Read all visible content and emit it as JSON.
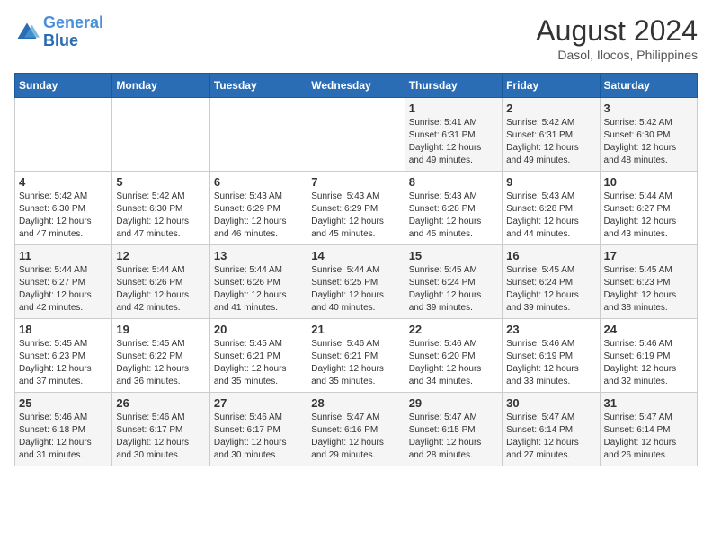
{
  "header": {
    "logo_line1": "General",
    "logo_line2": "Blue",
    "main_title": "August 2024",
    "subtitle": "Dasol, Ilocos, Philippines"
  },
  "days_of_week": [
    "Sunday",
    "Monday",
    "Tuesday",
    "Wednesday",
    "Thursday",
    "Friday",
    "Saturday"
  ],
  "weeks": [
    [
      {
        "day": "",
        "info": ""
      },
      {
        "day": "",
        "info": ""
      },
      {
        "day": "",
        "info": ""
      },
      {
        "day": "",
        "info": ""
      },
      {
        "day": "1",
        "info": "Sunrise: 5:41 AM\nSunset: 6:31 PM\nDaylight: 12 hours\nand 49 minutes."
      },
      {
        "day": "2",
        "info": "Sunrise: 5:42 AM\nSunset: 6:31 PM\nDaylight: 12 hours\nand 49 minutes."
      },
      {
        "day": "3",
        "info": "Sunrise: 5:42 AM\nSunset: 6:30 PM\nDaylight: 12 hours\nand 48 minutes."
      }
    ],
    [
      {
        "day": "4",
        "info": "Sunrise: 5:42 AM\nSunset: 6:30 PM\nDaylight: 12 hours\nand 47 minutes."
      },
      {
        "day": "5",
        "info": "Sunrise: 5:42 AM\nSunset: 6:30 PM\nDaylight: 12 hours\nand 47 minutes."
      },
      {
        "day": "6",
        "info": "Sunrise: 5:43 AM\nSunset: 6:29 PM\nDaylight: 12 hours\nand 46 minutes."
      },
      {
        "day": "7",
        "info": "Sunrise: 5:43 AM\nSunset: 6:29 PM\nDaylight: 12 hours\nand 45 minutes."
      },
      {
        "day": "8",
        "info": "Sunrise: 5:43 AM\nSunset: 6:28 PM\nDaylight: 12 hours\nand 45 minutes."
      },
      {
        "day": "9",
        "info": "Sunrise: 5:43 AM\nSunset: 6:28 PM\nDaylight: 12 hours\nand 44 minutes."
      },
      {
        "day": "10",
        "info": "Sunrise: 5:44 AM\nSunset: 6:27 PM\nDaylight: 12 hours\nand 43 minutes."
      }
    ],
    [
      {
        "day": "11",
        "info": "Sunrise: 5:44 AM\nSunset: 6:27 PM\nDaylight: 12 hours\nand 42 minutes."
      },
      {
        "day": "12",
        "info": "Sunrise: 5:44 AM\nSunset: 6:26 PM\nDaylight: 12 hours\nand 42 minutes."
      },
      {
        "day": "13",
        "info": "Sunrise: 5:44 AM\nSunset: 6:26 PM\nDaylight: 12 hours\nand 41 minutes."
      },
      {
        "day": "14",
        "info": "Sunrise: 5:44 AM\nSunset: 6:25 PM\nDaylight: 12 hours\nand 40 minutes."
      },
      {
        "day": "15",
        "info": "Sunrise: 5:45 AM\nSunset: 6:24 PM\nDaylight: 12 hours\nand 39 minutes."
      },
      {
        "day": "16",
        "info": "Sunrise: 5:45 AM\nSunset: 6:24 PM\nDaylight: 12 hours\nand 39 minutes."
      },
      {
        "day": "17",
        "info": "Sunrise: 5:45 AM\nSunset: 6:23 PM\nDaylight: 12 hours\nand 38 minutes."
      }
    ],
    [
      {
        "day": "18",
        "info": "Sunrise: 5:45 AM\nSunset: 6:23 PM\nDaylight: 12 hours\nand 37 minutes."
      },
      {
        "day": "19",
        "info": "Sunrise: 5:45 AM\nSunset: 6:22 PM\nDaylight: 12 hours\nand 36 minutes."
      },
      {
        "day": "20",
        "info": "Sunrise: 5:45 AM\nSunset: 6:21 PM\nDaylight: 12 hours\nand 35 minutes."
      },
      {
        "day": "21",
        "info": "Sunrise: 5:46 AM\nSunset: 6:21 PM\nDaylight: 12 hours\nand 35 minutes."
      },
      {
        "day": "22",
        "info": "Sunrise: 5:46 AM\nSunset: 6:20 PM\nDaylight: 12 hours\nand 34 minutes."
      },
      {
        "day": "23",
        "info": "Sunrise: 5:46 AM\nSunset: 6:19 PM\nDaylight: 12 hours\nand 33 minutes."
      },
      {
        "day": "24",
        "info": "Sunrise: 5:46 AM\nSunset: 6:19 PM\nDaylight: 12 hours\nand 32 minutes."
      }
    ],
    [
      {
        "day": "25",
        "info": "Sunrise: 5:46 AM\nSunset: 6:18 PM\nDaylight: 12 hours\nand 31 minutes."
      },
      {
        "day": "26",
        "info": "Sunrise: 5:46 AM\nSunset: 6:17 PM\nDaylight: 12 hours\nand 30 minutes."
      },
      {
        "day": "27",
        "info": "Sunrise: 5:46 AM\nSunset: 6:17 PM\nDaylight: 12 hours\nand 30 minutes."
      },
      {
        "day": "28",
        "info": "Sunrise: 5:47 AM\nSunset: 6:16 PM\nDaylight: 12 hours\nand 29 minutes."
      },
      {
        "day": "29",
        "info": "Sunrise: 5:47 AM\nSunset: 6:15 PM\nDaylight: 12 hours\nand 28 minutes."
      },
      {
        "day": "30",
        "info": "Sunrise: 5:47 AM\nSunset: 6:14 PM\nDaylight: 12 hours\nand 27 minutes."
      },
      {
        "day": "31",
        "info": "Sunrise: 5:47 AM\nSunset: 6:14 PM\nDaylight: 12 hours\nand 26 minutes."
      }
    ]
  ]
}
